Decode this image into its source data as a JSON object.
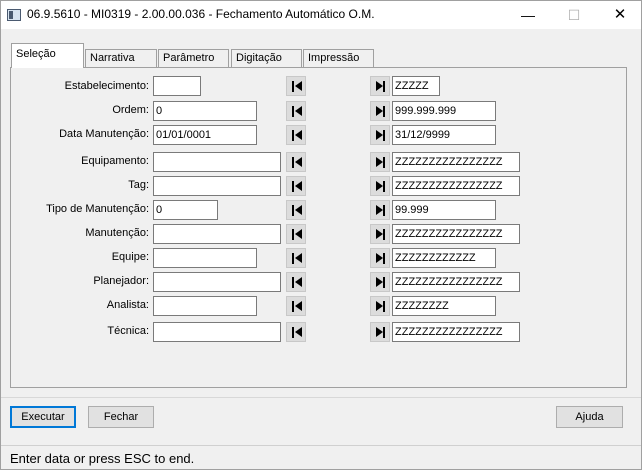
{
  "window": {
    "title": "06.9.5610 - MI0319 - 2.00.00.036 - Fechamento Automático O.M.",
    "minimize_glyph": "—",
    "maximize_glyph": "☐",
    "close_glyph": "✕"
  },
  "tabs": [
    {
      "label": "Seleção",
      "active": true
    },
    {
      "label": "Narrativa",
      "active": false
    },
    {
      "label": "Parâmetro",
      "active": false
    },
    {
      "label": "Digitação",
      "active": false
    },
    {
      "label": "Impressão",
      "active": false
    }
  ],
  "form": {
    "rows": [
      {
        "label": "Estabelecimento:",
        "from": "",
        "to": "ZZZZZ"
      },
      {
        "label": "Ordem:",
        "from": "0",
        "to": "999.999.999"
      },
      {
        "label": "Data Manutenção:",
        "from": "01/01/0001",
        "to": "31/12/9999"
      },
      {
        "label": "Equipamento:",
        "from": "",
        "to": "ZZZZZZZZZZZZZZZZ"
      },
      {
        "label": "Tag:",
        "from": "",
        "to": "ZZZZZZZZZZZZZZZZ"
      },
      {
        "label": "Tipo de Manutenção:",
        "from": "0",
        "to": "99.999"
      },
      {
        "label": "Manutenção:",
        "from": "",
        "to": "ZZZZZZZZZZZZZZZZ"
      },
      {
        "label": "Equipe:",
        "from": "",
        "to": "ZZZZZZZZZZZZ"
      },
      {
        "label": "Planejador:",
        "from": "",
        "to": "ZZZZZZZZZZZZZZZZ"
      },
      {
        "label": "Analista:",
        "from": "",
        "to": "ZZZZZZZZ"
      },
      {
        "label": "Técnica:",
        "from": "",
        "to": "ZZZZZZZZZZZZZZZZ"
      }
    ]
  },
  "buttons": {
    "execute": "Executar",
    "close": "Fechar",
    "help": "Ajuda"
  },
  "status": {
    "message": "Enter data or press ESC to end."
  },
  "colors": {
    "window_bg": "#f0f0f0",
    "field_bg": "#ffffff",
    "default_button_border": "#0078d7"
  }
}
